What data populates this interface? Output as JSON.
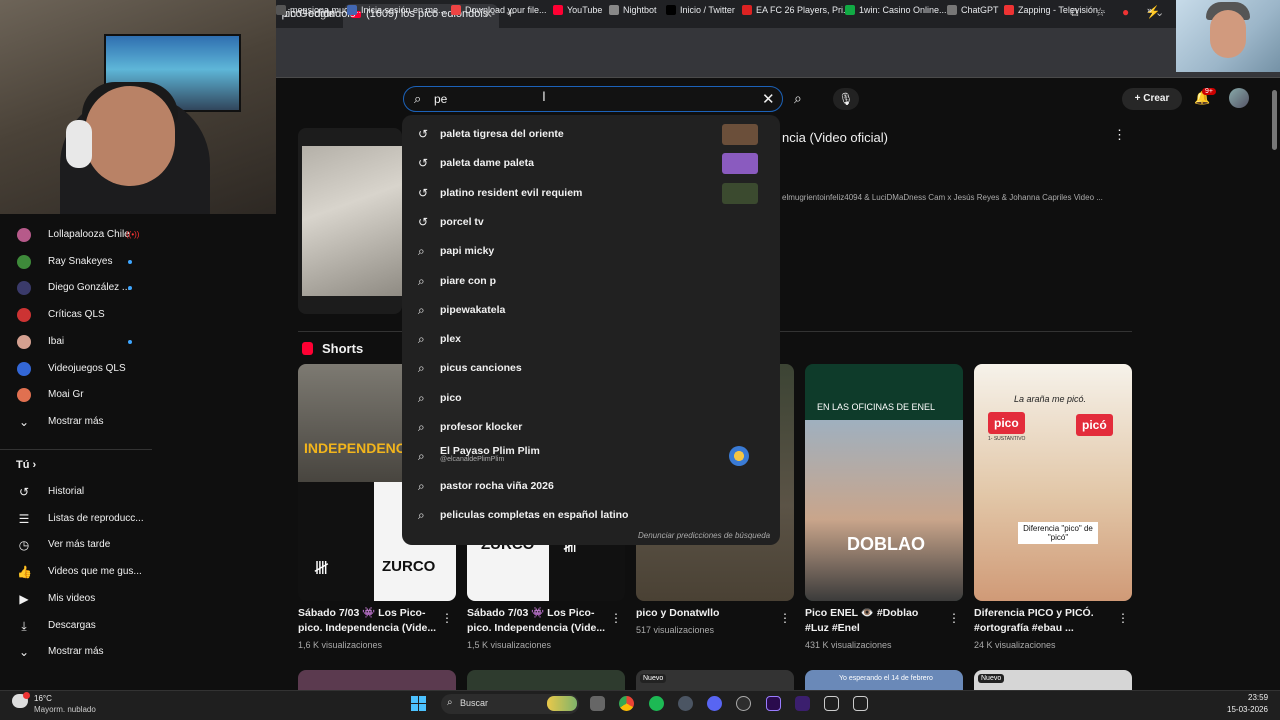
{
  "browser": {
    "tabs": [
      {
        "label": "on Google"
      },
      {
        "label": "(1609) los pico ediondois - You"
      }
    ],
    "new_tab_label": "+",
    "address": "-pico+ediondois",
    "bookmarks": [
      {
        "label": "mensiona much...",
        "color": "#555"
      },
      {
        "label": "Inicia sesión en me...",
        "color": "#4267b2"
      },
      {
        "label": "Download your file...",
        "color": "#e44"
      },
      {
        "label": "YouTube",
        "color": "#ff0033"
      },
      {
        "label": "Nightbot",
        "color": "#888"
      },
      {
        "label": "Inicio / Twitter",
        "color": "#000"
      },
      {
        "label": "EA FC 26 Players, Pri...",
        "color": "#d22"
      },
      {
        "label": "1win: Casino Online...",
        "color": "#1a4"
      },
      {
        "label": "ChatGPT",
        "color": "#777"
      },
      {
        "label": "Zapping - Televisión...",
        "color": "#e33"
      }
    ],
    "bookmarks_overflow": "»"
  },
  "search": {
    "value": "pe",
    "suggestions": [
      {
        "text": "paleta tigresa del oriente",
        "type": "history",
        "thumb": "#6b4f3a"
      },
      {
        "text": "paleta dame paleta",
        "type": "history",
        "thumb": "#8a5bbf"
      },
      {
        "text": "platino resident evil requiem",
        "type": "history",
        "thumb": "#3b4a2f"
      },
      {
        "text": "porcel tv",
        "type": "history"
      },
      {
        "text": "papi micky",
        "type": "search"
      },
      {
        "text": "piare con p",
        "type": "search"
      },
      {
        "text": "pipewakatela",
        "type": "search"
      },
      {
        "text": "plex",
        "type": "search"
      },
      {
        "text": "picus canciones",
        "type": "search"
      },
      {
        "text": "pico",
        "type": "search"
      },
      {
        "text": "profesor klocker",
        "type": "search"
      },
      {
        "text": "El Payaso Plim Plim",
        "sub": "@elcanaldePlimPlim",
        "type": "channel"
      },
      {
        "text": "pastor rocha viña 2026",
        "type": "search"
      },
      {
        "text": "peliculas completas en español latino",
        "type": "search"
      }
    ],
    "report_label": "Denunciar predicciones de búsqueda"
  },
  "header": {
    "create_label": "Crear",
    "notification_count": "9+"
  },
  "sidebar": {
    "subscriptions": [
      {
        "label": "Lollapalooza Chile",
        "indicator": "live",
        "color": "#b65a8a"
      },
      {
        "label": "Ray Snakeyes",
        "indicator": "dot",
        "color": "#3e8a3a"
      },
      {
        "label": "Diego González ...",
        "indicator": "dot",
        "color": "#3a3a6a"
      },
      {
        "label": "Críticas QLS",
        "indicator": "",
        "color": "#c33"
      },
      {
        "label": "Ibai",
        "indicator": "dot",
        "color": "#d4a090"
      },
      {
        "label": "Videojuegos QLS",
        "indicator": "",
        "color": "#3367d6"
      },
      {
        "label": "Moai Gr",
        "indicator": "",
        "color": "#e07050"
      },
      {
        "label": "Mostrar más",
        "indicator": "",
        "color": ""
      }
    ],
    "you_heading": "Tú",
    "you_items": [
      {
        "label": "Historial",
        "icon": "history-icon"
      },
      {
        "label": "Listas de reproducc...",
        "icon": "playlists-icon"
      },
      {
        "label": "Ver más tarde",
        "icon": "watch-later-icon"
      },
      {
        "label": "Videos que me gus...",
        "icon": "thumbs-up-icon"
      },
      {
        "label": "Mis videos",
        "icon": "my-videos-icon"
      },
      {
        "label": "Descargas",
        "icon": "downloads-icon"
      },
      {
        "label": "Mostrar más",
        "icon": "chevron-down-icon"
      }
    ]
  },
  "main": {
    "video_title": "ncia (Video oficial)",
    "video_meta": "elmugrientoinfeliz4094 & LuciDMaDness Cam x Jesús Reyes & Johanna Capriles Video ...",
    "shorts_label": "Shorts",
    "shorts": [
      {
        "title": "Sábado 7/03 👾 Los Pico-pico. Independencia (Vide...",
        "views": "1,6 K visualizaciones",
        "thumb_top": "INDEPENDENCIA",
        "thumb_bottom": "ZURCO"
      },
      {
        "title": "Sábado 7/03 👾 Los Pico-pico. Independencia (Vide...",
        "views": "1,5 K visualizaciones",
        "thumb_top": "",
        "thumb_bottom": "ZURCO"
      },
      {
        "title": "pico y Donatwllo",
        "views": "517 visualizaciones",
        "thumb_top": "",
        "thumb_bottom": ""
      },
      {
        "title": "Pico ENEL 👁️ #Doblao #Luz #Enel",
        "views": "431 K visualizaciones",
        "thumb_top": "EN LAS OFICINAS DE ENEL",
        "thumb_bottom": "DOBLAO"
      },
      {
        "title": "Diferencia PICO y PICÓ. #ortografía #ebau ...",
        "views": "24 K visualizaciones",
        "thumb_top": "La araña me picó.",
        "thumb_bottom": "Diferencia \"pico\" de \"picó\""
      }
    ],
    "short_tags": {
      "pico": "pico",
      "pico_accent": "picó",
      "sustantivo": "1- SUSTANTIVO",
      "tally": "𝍸"
    },
    "row2_badges": [
      "Nuevo",
      "Yo esperando el 14 de febrero",
      "Nuevo"
    ]
  },
  "taskbar": {
    "temperature": "16°C",
    "weather": "Mayorm. nublado",
    "search_label": "Buscar",
    "time": "23:59",
    "date": "15-03-2026"
  }
}
